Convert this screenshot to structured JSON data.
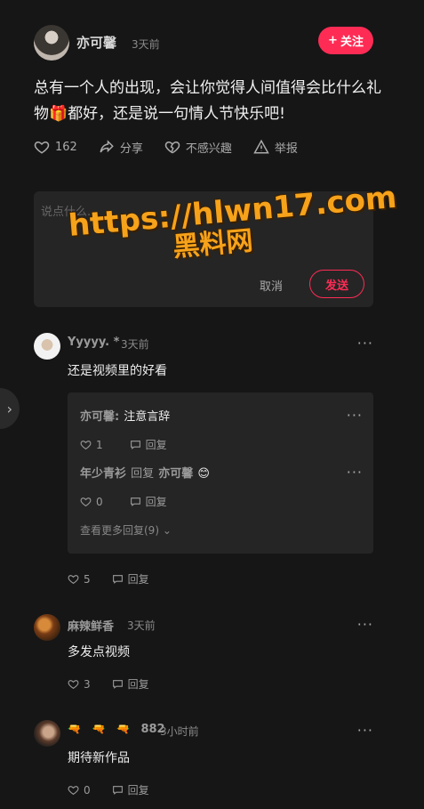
{
  "post": {
    "author": "亦可馨",
    "time": "3天前",
    "follow_label": "关注",
    "text": "总有一个人的出现，会让你觉得人间值得会比什么礼物🎁都好，还是说一句情人节快乐吧!",
    "like_count": "162",
    "share_label": "分享",
    "dislike_label": "不感兴趣",
    "report_label": "举报"
  },
  "comment_input": {
    "placeholder": "说点什么...",
    "cancel_label": "取消",
    "send_label": "发送"
  },
  "watermark": {
    "line1": "https://hlwn17.com",
    "line2": "黑料网"
  },
  "comments": [
    {
      "name": "Yyyyy. *",
      "time": "3天前",
      "text": "还是视频里的好看",
      "likes": "5",
      "reply_label": "回复",
      "replies": [
        {
          "name": "亦可馨:",
          "text": "注意言辞",
          "likes": "1",
          "reply_label": "回复"
        },
        {
          "name": "年少青衫",
          "mid": "回复",
          "target": "亦可馨",
          "emoji": "😊",
          "likes": "0",
          "reply_label": "回复"
        }
      ],
      "more_replies": "查看更多回复(9)"
    },
    {
      "name": "麻辣鲜香",
      "time": "3天前",
      "text": "多发点视频",
      "likes": "3",
      "reply_label": "回复"
    },
    {
      "name": "882",
      "badges": [
        "🔫",
        "🔫",
        "🔫"
      ],
      "time": "3小时前",
      "text": "期待新作品",
      "likes": "0",
      "reply_label": "回复"
    }
  ]
}
